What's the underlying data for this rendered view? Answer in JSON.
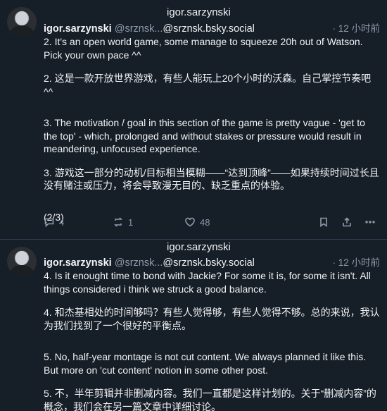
{
  "posts": [
    {
      "repost_label": "igor.sarzynski",
      "display_name": "igor.sarzynski",
      "handle": "@srznsk...",
      "handle_domain": "@srznsk.bsky.social",
      "time": "· 12 小时前",
      "paragraphs": [
        "2. It's an open world game, some manage to squeeze 20h out of Watson. Pick your own pace ^^",
        "2. 这是一款开放世界游戏，有些人能玩上20个小时的沃森。自己掌控节奏吧 ^^",
        "3. The motivation / goal in this section of the game is pretty vague - 'get to the top' - which, prolonged and without stakes or pressure would result in meandering, unfocused experience.",
        "3. 游戏这一部分的动机/目标相当模糊——“达到顶峰”——如果持续时间过长且没有赌注或压力，将会导致漫无目的、缺乏重点的体验。",
        "(2/3)"
      ],
      "reply_count": "4",
      "repost_count": "1",
      "like_count": "48"
    },
    {
      "repost_label": "igor.sarzynski",
      "display_name": "igor.sarzynski",
      "handle": "@srznsk...",
      "handle_domain": "@srznsk.bsky.social",
      "time": "· 12 小时前",
      "paragraphs": [
        "4. Is it enought time to bond with Jackie? For some it is, for some it isn't. All things considered i think we struck a good balance.",
        "4. 和杰基相处的时间够吗？有些人觉得够，有些人觉得不够。总的来说，我认为我们找到了一个很好的平衡点。",
        "5. No, half-year montage is not cut content. We always planned it like this. But more on 'cut content' notion in some other post.",
        "5. 不，半年剪辑并非删减内容。我们一直都是这样计划的。关于“删减内容”的概念，我们会在另一篇文章中详细讨论。"
      ]
    }
  ],
  "icons": [
    "reply-icon",
    "repost-icon",
    "like-icon",
    "bookmark-icon",
    "share-icon",
    "more-icon"
  ]
}
